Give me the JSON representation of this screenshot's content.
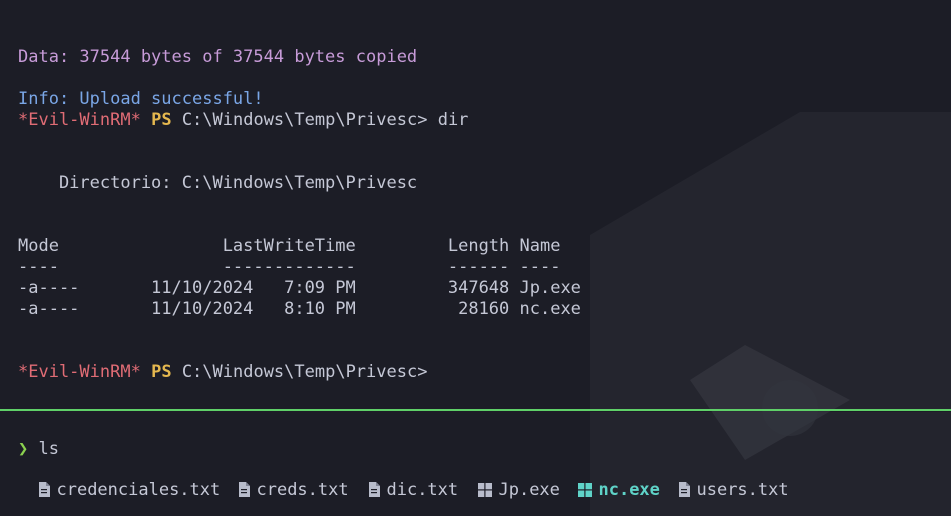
{
  "top_pane": {
    "data_line": "Data: 37544 bytes of 37544 bytes copied",
    "info_line": "Info: Upload successful!",
    "prompt1": {
      "shell": "*Evil-WinRM*",
      "ps": "PS",
      "path": "C:\\Windows\\Temp\\Privesc>",
      "command": "dir"
    },
    "directory_line": "    Directorio: C:\\Windows\\Temp\\Privesc",
    "table_header": "Mode                LastWriteTime         Length Name",
    "table_rule": "----                -------------         ------ ----",
    "rows": [
      "-a----       11/10/2024   7:09 PM         347648 Jp.exe",
      "-a----       11/10/2024   8:10 PM          28160 nc.exe"
    ],
    "prompt2": {
      "shell": "*Evil-WinRM*",
      "ps": "PS",
      "path": "C:\\Windows\\Temp\\Privesc>"
    }
  },
  "bottom_pane": {
    "prompt_symbol": "❯",
    "command": "ls",
    "files": [
      {
        "name": "credenciales.txt",
        "icon": "file-icon"
      },
      {
        "name": "creds.txt",
        "icon": "file-icon"
      },
      {
        "name": "dic.txt",
        "icon": "file-icon"
      },
      {
        "name": "Jp.exe",
        "icon": "windows-icon"
      },
      {
        "name": "nc.exe",
        "icon": "windows-icon",
        "highlight": true
      },
      {
        "name": "users.txt",
        "icon": "file-icon"
      }
    ]
  },
  "colors": {
    "background": "#1c1d26",
    "divider": "#5fd068",
    "prompt_red": "#e06c75",
    "ps_yellow": "#e5b84f",
    "info_blue": "#7aa6e6",
    "data_purple": "#c79bd8",
    "highlight_cyan": "#5fd3c8"
  }
}
